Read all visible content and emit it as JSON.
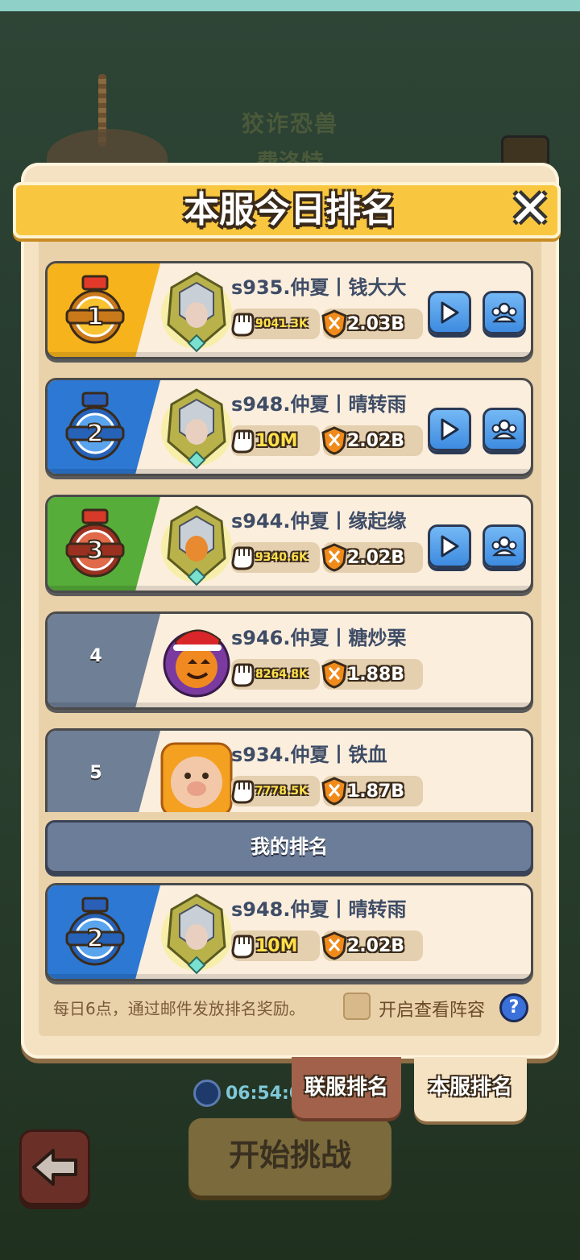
{
  "background": {
    "title_line1": "狡诈恐兽",
    "title_line2": "费洛特",
    "timer": "06:54:0",
    "start_button": "开始挑战"
  },
  "dialog": {
    "title": "本服今日排名",
    "close_icon": "close-icon"
  },
  "rankings": [
    {
      "rank": "1",
      "name": "s935.仲夏丨钱大大",
      "power": "9041.3K",
      "combat": "2.03B",
      "avatar": "armored-knight-avatar",
      "has_actions": true
    },
    {
      "rank": "2",
      "name": "s948.仲夏丨晴转雨",
      "power": "10M",
      "combat": "2.02B",
      "avatar": "armored-knight-avatar",
      "has_actions": true
    },
    {
      "rank": "3",
      "name": "s944.仲夏丨缘起缘",
      "power": "9340.6K",
      "combat": "2.02B",
      "avatar": "golden-warrior-avatar",
      "has_actions": true
    },
    {
      "rank": "4",
      "name": "s946.仲夏丨糖炒栗",
      "power": "8264.8K",
      "combat": "1.88B",
      "avatar": "pumpkin-avatar",
      "has_actions": false
    },
    {
      "rank": "5",
      "name": "s934.仲夏丨铁血",
      "power": "7778.5K",
      "combat": "1.87B",
      "avatar": "piglet-avatar",
      "has_actions": false
    }
  ],
  "my_rank": {
    "label": "我的排名",
    "rank": "2",
    "name": "s948.仲夏丨晴转雨",
    "power": "10M",
    "combat": "2.02B"
  },
  "footer": {
    "note": "每日6点，通过邮件发放排名奖励。",
    "checkbox_label": "开启查看阵容",
    "help": "?"
  },
  "tabs": {
    "cross_server": "联服排名",
    "local_server": "本服排名"
  },
  "colors": {
    "gold": "#f6b31c",
    "silver_blue": "#2c78d3",
    "bronze_green": "#56ad3a",
    "grey": "#6e7f96",
    "header": "#f8c63f"
  }
}
